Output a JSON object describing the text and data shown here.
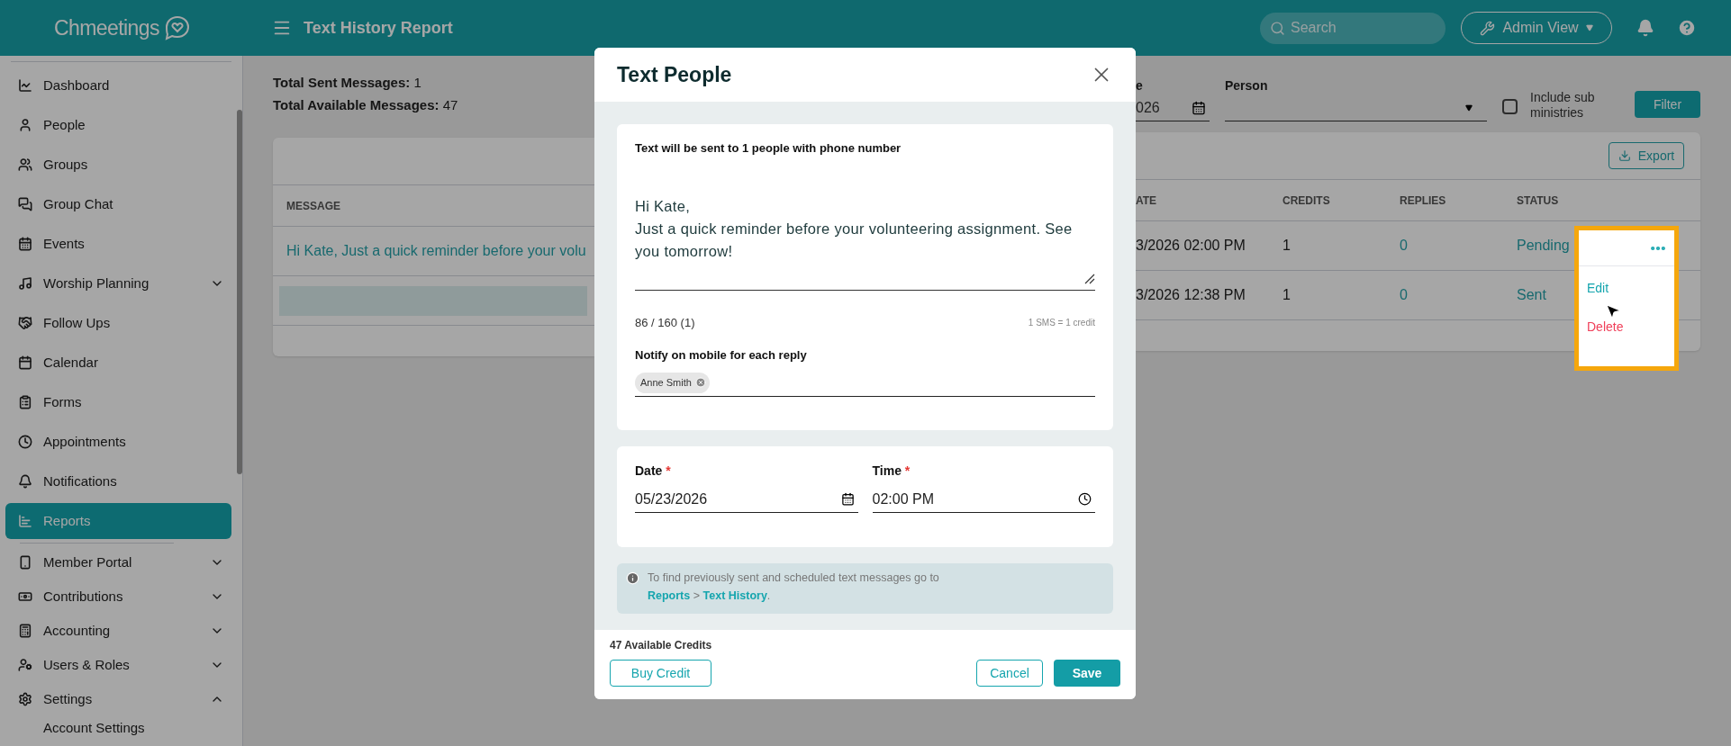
{
  "header": {
    "logo": "Chmeetings",
    "title": "Text History Report",
    "search": {
      "placeholder": "Search"
    },
    "view_button": "Admin View"
  },
  "sidebar": {
    "items": [
      {
        "label": "Dashboard",
        "selected": false
      },
      {
        "label": "People",
        "selected": false
      },
      {
        "label": "Groups",
        "selected": false
      },
      {
        "label": "Group Chat",
        "selected": false
      },
      {
        "label": "Events",
        "selected": false
      },
      {
        "label": "Worship Planning",
        "selected": false,
        "expanded": false
      },
      {
        "label": "Follow Ups",
        "selected": false
      },
      {
        "label": "Calendar",
        "selected": false
      },
      {
        "label": "Forms",
        "selected": false
      },
      {
        "label": "Appointments",
        "selected": false
      },
      {
        "label": "Notifications",
        "selected": false
      },
      {
        "label": "Reports",
        "selected": true
      },
      {
        "label": "Member Portal",
        "selected": false,
        "expanded": false
      },
      {
        "label": "Contributions",
        "selected": false,
        "expanded": false
      },
      {
        "label": "Accounting",
        "selected": false,
        "expanded": false
      },
      {
        "label": "Users & Roles",
        "selected": false,
        "expanded": false
      },
      {
        "label": "Settings",
        "selected": false,
        "expanded": true,
        "children": [
          {
            "label": "Account Settings",
            "selected": false
          }
        ]
      }
    ]
  },
  "summary": [
    "**Total Sent Messages:** 1",
    "**Total Available Messages:** 47"
  ],
  "filters": {
    "date": {
      "label": "e",
      "value": "026"
    },
    "person": {
      "label": "Person"
    },
    "include_sub_ministries": {
      "label": "Include sub ministries",
      "checked": false
    },
    "filter_button": "Filter"
  },
  "table": {
    "export_button": "Export",
    "columns": [
      "MESSAGE",
      "ATE",
      "CREDITS",
      "REPLIES",
      "STATUS"
    ],
    "rows": [
      {
        "kind": "text",
        "message": "Hi Kate, Just a quick reminder before your volu",
        "date": "3/2026 02:00 PM",
        "credits": "1",
        "replies": "0",
        "status": "Pending"
      },
      {
        "kind": "loading",
        "date": "3/2026 12:38 PM",
        "credits": "1",
        "replies": "0",
        "status": "Sent"
      }
    ]
  },
  "row_menu": {
    "items": [
      {
        "label": "Edit",
        "kind": "action"
      },
      {
        "label": "Delete",
        "kind": "danger"
      }
    ]
  },
  "modal": {
    "title": "Text People",
    "recipients": "Text will be sent to 1 people with phone number",
    "message": "Hi Kate,\nJust a quick reminder before your volunteering assignment. See you tomorrow!",
    "counter": "86 / 160 (1)",
    "rate": "1 SMS = 1 credit",
    "notify": {
      "label": "Notify on mobile for each reply",
      "chips": [
        "Anne Smith"
      ]
    },
    "date": {
      "label": "Date",
      "required_mark": "*",
      "value": "05/23/2026"
    },
    "time": {
      "label": "Time",
      "required_mark": "*",
      "value": "02:00 PM"
    },
    "info": {
      "text": "To find previously sent and scheduled text messages go to",
      "link_1": "Reports",
      "separator": ">",
      "link_2": "Text History",
      "end": "."
    },
    "credits": "47 Available Credits",
    "buy_button": "Buy Credit",
    "cancel_button": "Cancel",
    "save_button": "Save"
  }
}
